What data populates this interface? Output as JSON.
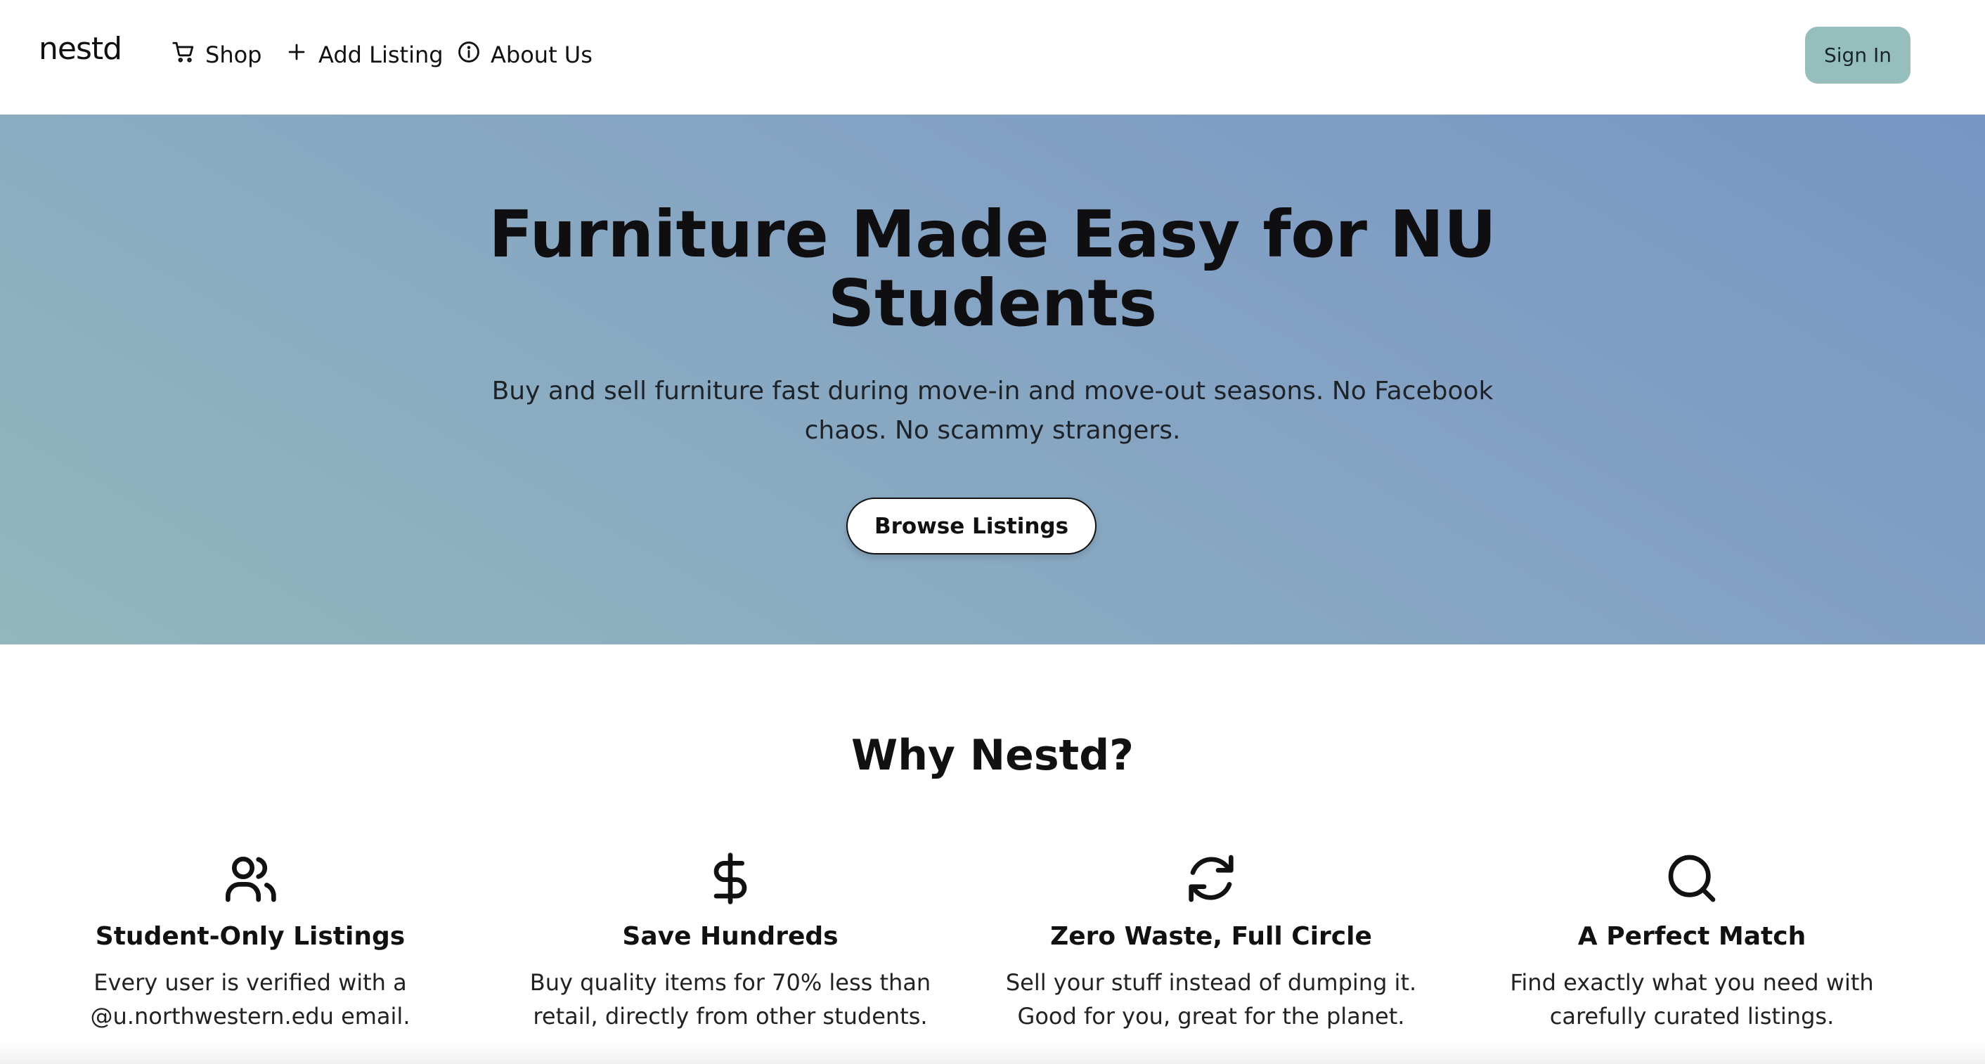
{
  "nav": {
    "logo": "nestd",
    "items": [
      {
        "label": "Shop",
        "icon": "cart-icon"
      },
      {
        "label": "Add Listing",
        "icon": "plus-icon"
      },
      {
        "label": "About Us",
        "icon": "info-icon"
      }
    ],
    "sign_in": "Sign In"
  },
  "hero": {
    "title": "Furniture Made Easy for NU Students",
    "subtitle": "Buy and sell furniture fast during move-in and move-out seasons. No Facebook chaos. No scammy strangers.",
    "cta": "Browse Listings"
  },
  "why": {
    "title": "Why Nestd?",
    "features": [
      {
        "icon": "users-icon",
        "title": "Student-Only Listings",
        "text": "Every user is verified with a @u.northwestern.edu email."
      },
      {
        "icon": "dollar-icon",
        "title": "Save Hundreds",
        "text": "Buy quality items for 70% less than retail, directly from other students."
      },
      {
        "icon": "refresh-icon",
        "title": "Zero Waste, Full Circle",
        "text": "Sell your stuff instead of dumping it. Good for you, great for the planet."
      },
      {
        "icon": "search-icon",
        "title": "A Perfect Match",
        "text": "Find exactly what you need with carefully curated listings."
      }
    ]
  },
  "colors": {
    "sign_in_bg": "#96bebd",
    "hero_gradient_start": "#92b7be",
    "hero_gradient_end": "#7895c4"
  }
}
